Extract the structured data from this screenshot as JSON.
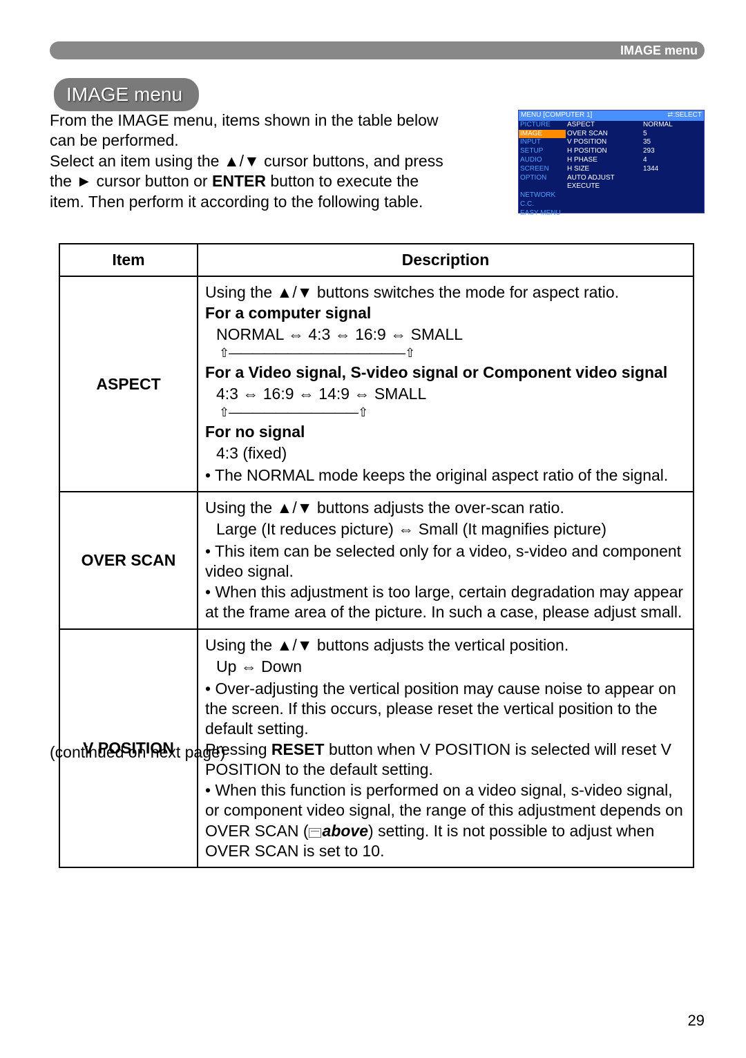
{
  "header": {
    "label": "IMAGE menu"
  },
  "title": "IMAGE menu",
  "intro": {
    "line1": "From the IMAGE menu, items shown in the table below can be performed.",
    "line2a": "Select an item using the ▲/▼ cursor buttons, and press the ► cursor button or ",
    "line2b": "ENTER",
    "line2c": " button to execute the item. Then perform it according to the following table."
  },
  "menushot": {
    "title_left": "MENU [COMPUTER 1]",
    "title_right": "⮂:SELECT",
    "rows": [
      {
        "l": "PICTURE",
        "m": "ASPECT",
        "r": "NORMAL"
      },
      {
        "l": "IMAGE",
        "m": "OVER SCAN",
        "r": "5",
        "hl": true
      },
      {
        "l": "INPUT",
        "m": "V POSITION",
        "r": "35"
      },
      {
        "l": "SETUP",
        "m": "H POSITION",
        "r": "293"
      },
      {
        "l": "AUDIO",
        "m": "H PHASE",
        "r": "4"
      },
      {
        "l": "SCREEN",
        "m": "H SIZE",
        "r": "1344"
      },
      {
        "l": "OPTION",
        "m": "AUTO ADJUST EXECUTE",
        "r": ""
      },
      {
        "l": "NETWORK",
        "m": "",
        "r": ""
      },
      {
        "l": "C.C.",
        "m": "",
        "r": ""
      },
      {
        "l": "EASY MENU",
        "m": "",
        "r": ""
      }
    ]
  },
  "table": {
    "head_item": "Item",
    "head_desc": "Description",
    "aspect": {
      "name": "ASPECT",
      "l1": "Using the ▲/▼ buttons switches the mode for aspect ratio.",
      "sub1": "For a computer signal",
      "seq1": "NORMAL ⇔ 4:3 ⇔ 16:9 ⇔ SMALL",
      "loop1": "⇧———————————————⇧",
      "sub2": "For a Video signal, S-video signal or Component video signal",
      "seq2": "4:3 ⇔ 16:9 ⇔ 14:9 ⇔ SMALL",
      "loop2": "⇧———————————⇧",
      "sub3": "For no signal",
      "seq3": "4:3 (fixed)",
      "note": "• The NORMAL mode keeps the original aspect ratio of the signal."
    },
    "overscan": {
      "name": "OVER SCAN",
      "l1": "Using the ▲/▼ buttons adjusts the over-scan ratio.",
      "seq": "Large (It reduces picture) ⇔ Small (It magnifies picture)",
      "b1": "• This item can be selected only for a video, s-video and component video signal.",
      "b2": "• When this adjustment is too large, certain degradation may appear at the frame area of the picture. In such a case, please adjust small."
    },
    "vpos": {
      "name": "V POSITION",
      "l1": "Using the ▲/▼ buttons adjusts the vertical position.",
      "seq": "Up ⇔ Down",
      "b1a": "• Over-adjusting the vertical position may cause noise to appear on the screen. If this occurs, please reset the vertical position to the default setting.",
      "b1b_pre": "Pressing ",
      "b1b_bold": "RESET",
      "b1b_post": " button when V POSITION is selected will reset V POSITION to the default setting.",
      "b2a": "• When this function is performed on a video signal, s-video signal, or component video signal, the range of this adjustment depends on OVER SCAN (",
      "b2_ref": "above",
      "b2b": ") setting. It is not possible to adjust when OVER SCAN is set to 10."
    }
  },
  "continued": "(continued on next page)",
  "page_num": "29"
}
